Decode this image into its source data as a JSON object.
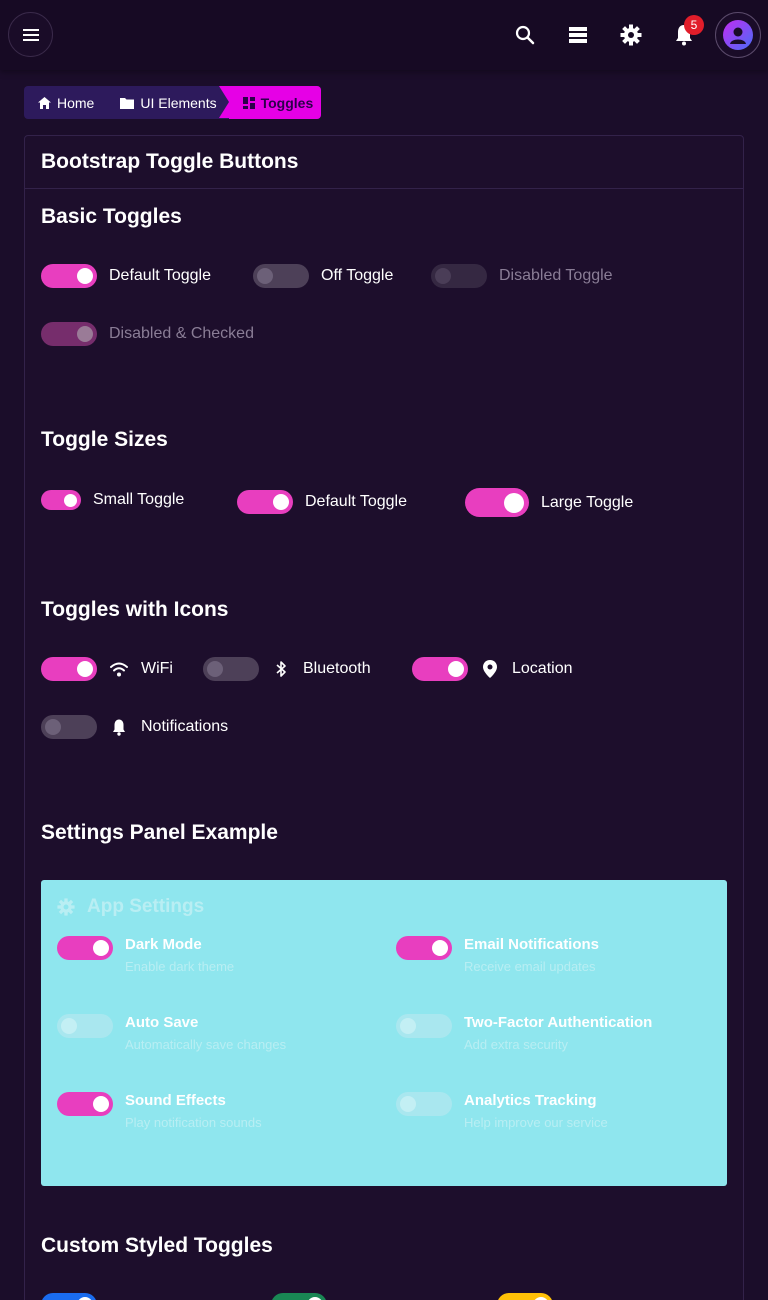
{
  "topbar": {
    "notification_count": "5",
    "icons": [
      "menu-icon",
      "search-icon",
      "database-icon",
      "gear-icon",
      "bell-icon",
      "user-icon"
    ]
  },
  "breadcrumb": {
    "items": [
      {
        "label": "Home",
        "icon": "home-icon"
      },
      {
        "label": "UI Elements",
        "icon": "folder-icon"
      },
      {
        "label": "Toggles",
        "icon": "grid-icon"
      }
    ]
  },
  "card": {
    "title": "Bootstrap Toggle Buttons"
  },
  "basic": {
    "title": "Basic Toggles",
    "items": [
      {
        "label": "Default Toggle",
        "checked": true,
        "disabled": false
      },
      {
        "label": "Off Toggle",
        "checked": false,
        "disabled": false
      },
      {
        "label": "Disabled Toggle",
        "checked": false,
        "disabled": true
      },
      {
        "label": "Disabled & Checked",
        "checked": true,
        "disabled": true
      }
    ]
  },
  "sizes": {
    "title": "Toggle Sizes",
    "items": [
      {
        "label": "Small Toggle",
        "checked": true
      },
      {
        "label": "Default Toggle",
        "checked": true
      },
      {
        "label": "Large Toggle",
        "checked": true
      }
    ]
  },
  "icons_section": {
    "title": "Toggles with Icons",
    "items": [
      {
        "label": "WiFi",
        "icon": "wifi-icon",
        "checked": true
      },
      {
        "label": "Bluetooth",
        "icon": "bluetooth-icon",
        "checked": false
      },
      {
        "label": "Location",
        "icon": "location-pin-icon",
        "checked": true
      },
      {
        "label": "Notifications",
        "icon": "bell-icon",
        "checked": false
      }
    ]
  },
  "settings": {
    "title": "Settings Panel Example",
    "panel_title": "App Settings",
    "items": [
      {
        "label": "Dark Mode",
        "desc": "Enable dark theme",
        "checked": true
      },
      {
        "label": "Email Notifications",
        "desc": "Receive email updates",
        "checked": true
      },
      {
        "label": "Auto Save",
        "desc": "Automatically save changes",
        "checked": false
      },
      {
        "label": "Two-Factor Authentication",
        "desc": "Add extra security",
        "checked": false
      },
      {
        "label": "Sound Effects",
        "desc": "Play notification sounds",
        "checked": true
      },
      {
        "label": "Analytics Tracking",
        "desc": "Help improve our service",
        "checked": false
      }
    ]
  },
  "custom": {
    "title": "Custom Styled Toggles"
  },
  "colors": {
    "background": "#1b0d2a",
    "toggle_on": "#e83ebf",
    "breadcrumb_active": "#e600e6",
    "panel_bg": "#8fe6ee",
    "badge": "#e11d2a"
  }
}
